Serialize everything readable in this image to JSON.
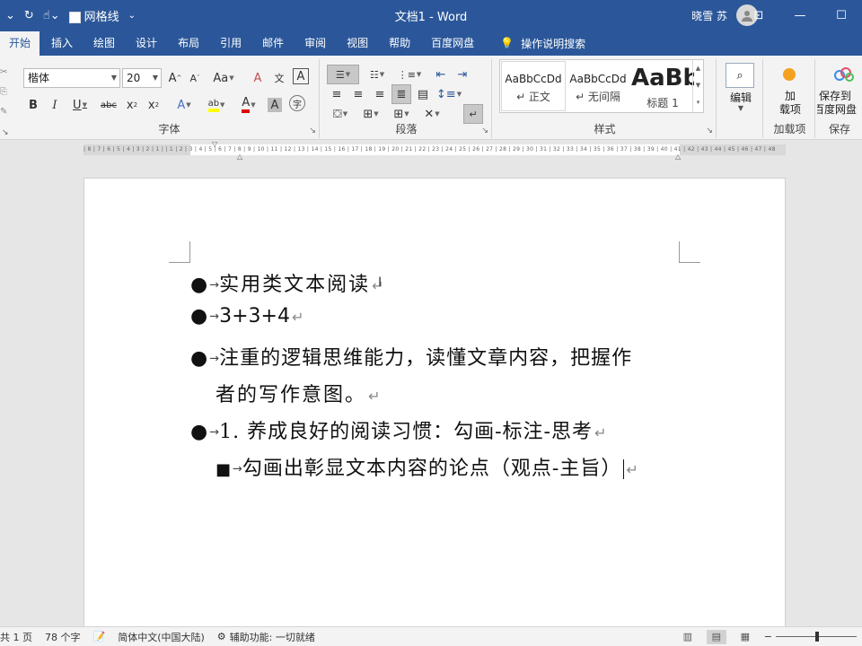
{
  "titlebar": {
    "quick_access": {
      "gridlines_label": "网格线"
    },
    "doc_title": "文档1  -  Word",
    "user_name": "晓雪 苏"
  },
  "tabs": [
    {
      "label": "开始",
      "active": true
    },
    {
      "label": "插入"
    },
    {
      "label": "绘图"
    },
    {
      "label": "设计"
    },
    {
      "label": "布局"
    },
    {
      "label": "引用"
    },
    {
      "label": "邮件"
    },
    {
      "label": "审阅"
    },
    {
      "label": "视图"
    },
    {
      "label": "帮助"
    },
    {
      "label": "百度网盘"
    }
  ],
  "tell_me": "操作说明搜索",
  "ribbon": {
    "font": {
      "group_label": "字体",
      "font_name": "楷体",
      "font_size": "20",
      "grow": "A",
      "shrink": "A",
      "case": "Aa",
      "clear": "A",
      "phonetic": "文",
      "border_char": "A",
      "bold": "B",
      "italic": "I",
      "underline": "U",
      "strike": "abc",
      "subscript": "x",
      "superscript": "x",
      "effects": "A",
      "highlight": "ab",
      "font_color": "A",
      "shading_char": "A",
      "enclose": "字"
    },
    "paragraph": {
      "group_label": "段落"
    },
    "styles": {
      "group_label": "样式",
      "items": [
        {
          "preview": "AaBbCcDd",
          "name": "↵ 正文"
        },
        {
          "preview": "AaBbCcDd",
          "name": "↵ 无间隔"
        },
        {
          "preview": "AaBb",
          "name": "标题 1"
        }
      ]
    },
    "editing": {
      "label": "编辑"
    },
    "addins": {
      "label_1": "加",
      "label_2": "载项",
      "group_label": "加载项"
    },
    "save": {
      "label_1": "保存到",
      "label_2": "百度网盘",
      "group_label": "保存"
    }
  },
  "ruler": {
    "ticks": "| 8 | 7 | 6 | 5 | 4 | 3 | 2 | 1 |   | 1 | 2 | 3 | 4 | 5 | 6 | 7 | 8 | 9 | 10 | 11 | 12 | 13 | 14 | 15 | 16 | 17 | 18 | 19 | 20 | 21 | 22 | 23 | 24 | 25 | 26 | 27 | 28 | 29 | 30 | 31 | 32 | 33 | 34 | 35 | 36 | 37 | 38 | 39 | 40 | 41 | 42 | 43 | 44 | 45 | 46 | 47 | 48"
  },
  "document": {
    "lines": [
      {
        "bullet": "●",
        "text": "实用类文本阅读"
      },
      {
        "bullet": "●",
        "text": "3+3+4"
      },
      {
        "bullet": "●",
        "text": "注重的逻辑思维能力，读懂文章内容，把握作"
      },
      {
        "bullet": "",
        "text": "者的写作意图。"
      },
      {
        "bullet": "●",
        "text": "1. 养成良好的阅读习惯：勾画-标注-思考"
      },
      {
        "bullet": "■",
        "text": "勾画出彰显文本内容的论点（观点-主旨）"
      }
    ]
  },
  "status": {
    "page": "共 1 页",
    "words": "78 个字",
    "language": "简体中文(中国大陆)",
    "accessibility": "辅助功能: 一切就绪"
  },
  "colors": {
    "titlebar": "#2b579a",
    "ribbon": "#f3f3f3",
    "highlight_yellow": "#ffff00",
    "font_red": "#e00000"
  }
}
